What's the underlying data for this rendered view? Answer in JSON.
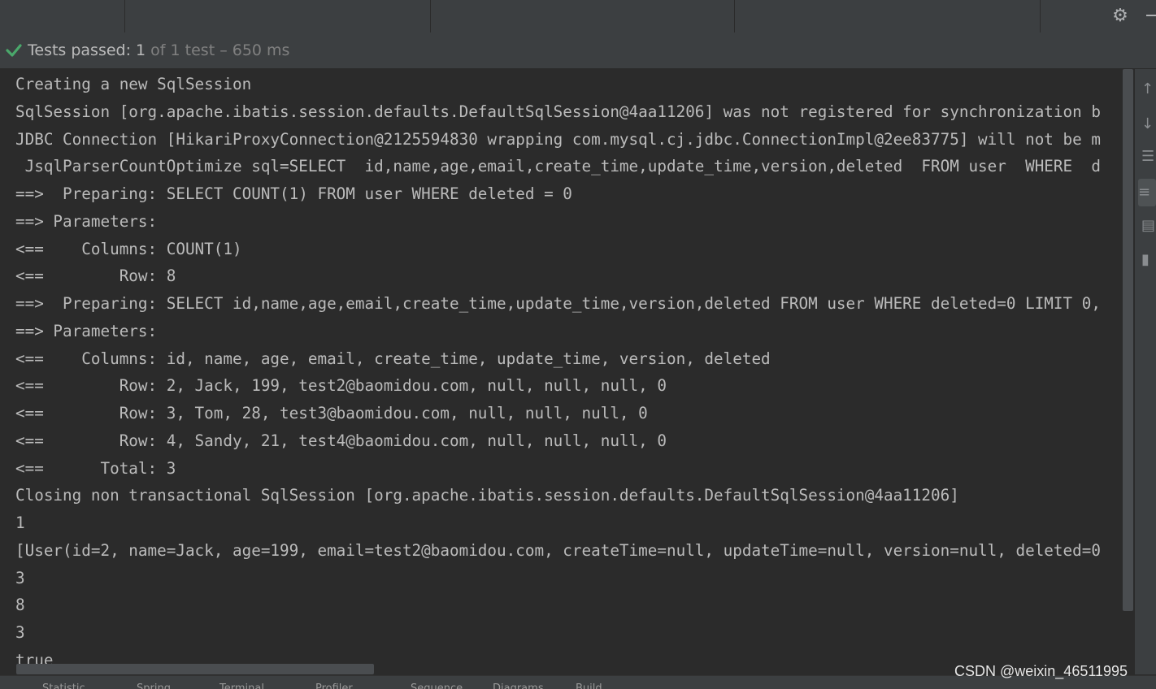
{
  "status": {
    "passed_label": "Tests passed: 1",
    "detail": " of 1 test – 650 ms"
  },
  "console_lines": [
    "Creating a new SqlSession",
    "SqlSession [org.apache.ibatis.session.defaults.DefaultSqlSession@4aa11206] was not registered for synchronization b",
    "JDBC Connection [HikariProxyConnection@2125594830 wrapping com.mysql.cj.jdbc.ConnectionImpl@2ee83775] will not be m",
    " JsqlParserCountOptimize sql=SELECT  id,name,age,email,create_time,update_time,version,deleted  FROM user  WHERE  d",
    "==>  Preparing: SELECT COUNT(1) FROM user WHERE deleted = 0",
    "==> Parameters: ",
    "<==    Columns: COUNT(1)",
    "<==        Row: 8",
    "==>  Preparing: SELECT id,name,age,email,create_time,update_time,version,deleted FROM user WHERE deleted=0 LIMIT 0,",
    "==> Parameters: ",
    "<==    Columns: id, name, age, email, create_time, update_time, version, deleted",
    "<==        Row: 2, Jack, 199, test2@baomidou.com, null, null, null, 0",
    "<==        Row: 3, Tom, 28, test3@baomidou.com, null, null, null, 0",
    "<==        Row: 4, Sandy, 21, test4@baomidou.com, null, null, null, 0",
    "<==      Total: 3",
    "Closing non transactional SqlSession [org.apache.ibatis.session.defaults.DefaultSqlSession@4aa11206]",
    "1",
    "[User(id=2, name=Jack, age=199, email=test2@baomidou.com, createTime=null, updateTime=null, version=null, deleted=0",
    "3",
    "8",
    "3",
    "true"
  ],
  "bottom_tabs": [
    "Statistic",
    "Spring",
    "Terminal",
    "Profiler",
    "Sequence",
    "Diagrams",
    "Build"
  ],
  "watermark": "CSDN @weixin_46511995",
  "colors": {
    "check": "#4aa86b",
    "text": "#bbbbbb",
    "background": "#2b2b2b"
  },
  "icons": [
    "gear-icon",
    "check-icon",
    "arrow-up-icon",
    "arrow-down-icon",
    "soft-wrap-icon",
    "scroll-to-end-icon",
    "print-icon",
    "trash-icon"
  ]
}
